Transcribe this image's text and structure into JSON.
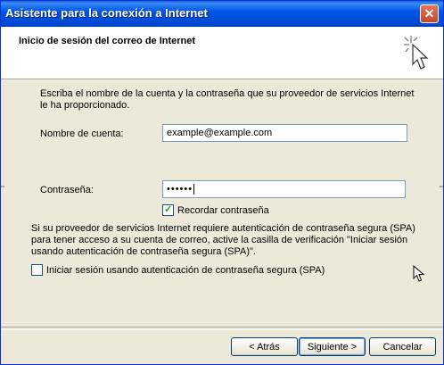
{
  "window": {
    "title": "Asistente para la conexión a Internet"
  },
  "header": {
    "title": "Inicio de sesión del correo de Internet"
  },
  "form": {
    "description": "Escriba el nombre de la cuenta y la contraseña que su proveedor de servicios Internet le ha proporcionado.",
    "account_label": "Nombre de cuenta:",
    "account_value": "example@example.com",
    "password_label": "Contraseña:",
    "password_value": "••••••",
    "remember_label": "Recordar contraseña",
    "remember_checked": true,
    "spa_description": "Si su proveedor de servicios Internet requiere autenticación de contraseña segura (SPA) para tener acceso a su cuenta de correo, active la casilla de verificación \"Iniciar sesión usando autenticación de contraseña segura (SPA)\".",
    "spa_label": "Iniciar sesión usando autenticación de contraseña segura (SPA)",
    "spa_checked": false
  },
  "buttons": {
    "back": "< Atrás",
    "next": "Siguiente >",
    "cancel": "Cancelar"
  },
  "icons": {
    "close": "close-icon",
    "wizard": "wizard-cursor-icon",
    "cursor": "mouse-pointer-icon"
  }
}
